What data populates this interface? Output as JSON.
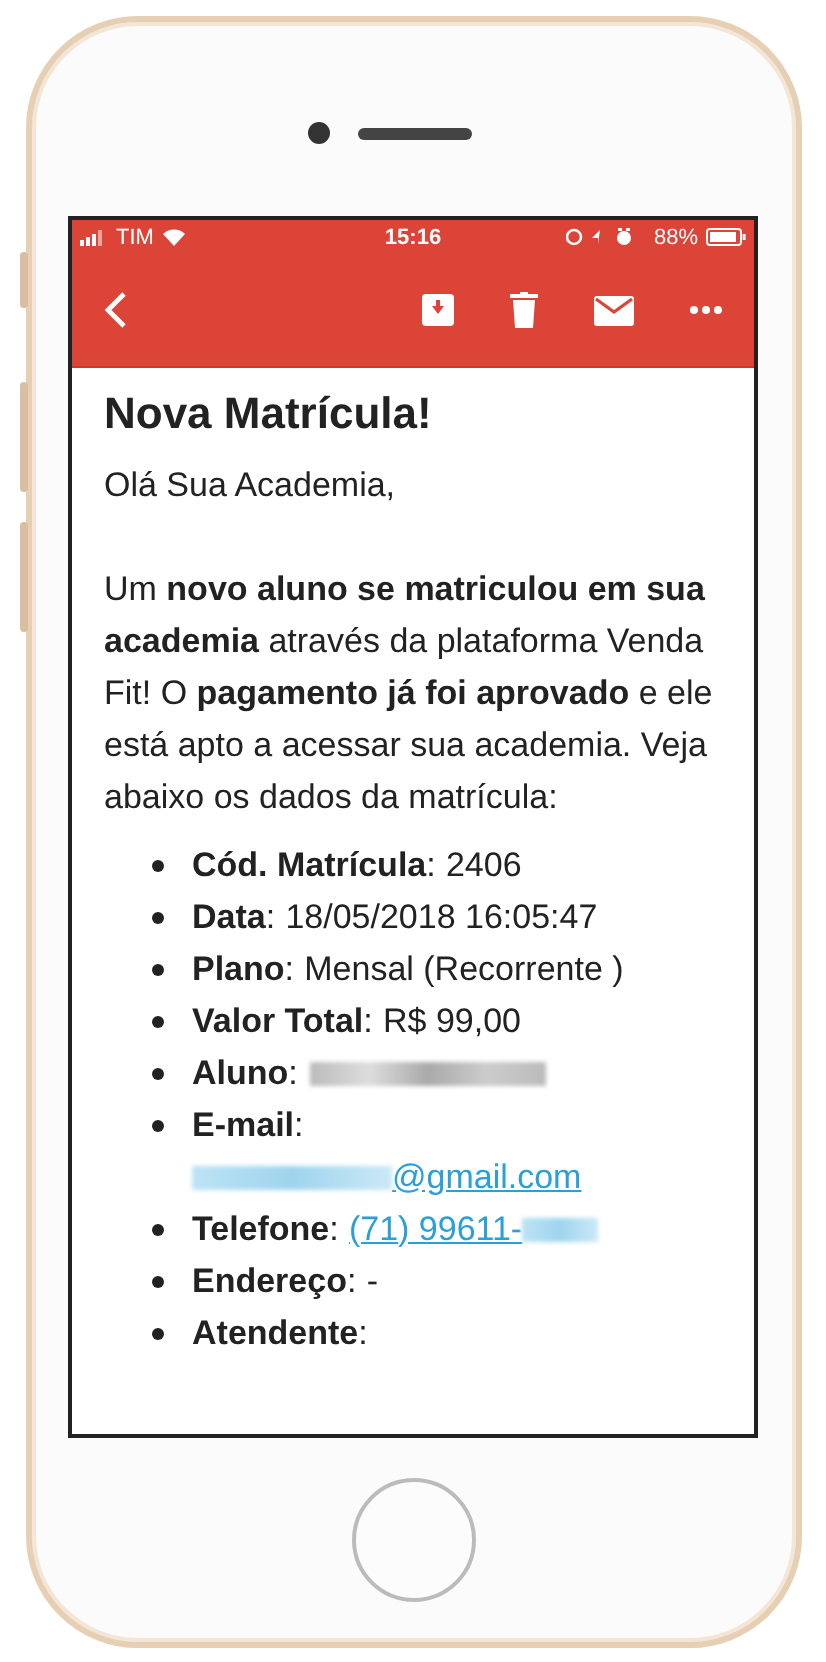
{
  "status_bar": {
    "carrier": "TIM",
    "time": "15:16",
    "battery": "88%"
  },
  "email": {
    "title": "Nova Matrícula!",
    "greeting": "Olá Sua Academia,",
    "intro": "Um **novo aluno se matriculou em sua academia** através da plataforma Venda Fit! O **pagamento já foi aprovado** e ele está apto a acessar sua academia. Veja abaixo os dados da matrícula:",
    "details": [
      {
        "label": "**Cód. Matrícula**:",
        "parts": [
          {
            "kind": "text",
            "text": "2406"
          }
        ]
      },
      {
        "label": "**Data**:",
        "parts": [
          {
            "kind": "text",
            "text": "18/05/2018 16:05:47"
          }
        ]
      },
      {
        "label": "**Plano**:",
        "parts": [
          {
            "kind": "text",
            "text": "Mensal (Recorrente )"
          }
        ]
      },
      {
        "label": "**Valor Total**:",
        "parts": [
          {
            "kind": "text",
            "text": "R$ 99,00"
          }
        ]
      },
      {
        "label": "**Aluno**:",
        "parts": [
          {
            "kind": "blur"
          }
        ]
      },
      {
        "label": "**E-mail**:",
        "value_on_new_line": true,
        "parts": [
          {
            "kind": "blur_link"
          },
          {
            "kind": "link",
            "text": "@gmail.com"
          }
        ]
      },
      {
        "label": "**Telefone**:",
        "parts": [
          {
            "kind": "link",
            "text": "(71) 99611-"
          },
          {
            "kind": "blur_link"
          }
        ]
      },
      {
        "label": "**Endereço**:",
        "parts": [
          {
            "kind": "text",
            "text": "-"
          }
        ]
      },
      {
        "label": "**Atendente**:"
      }
    ]
  }
}
